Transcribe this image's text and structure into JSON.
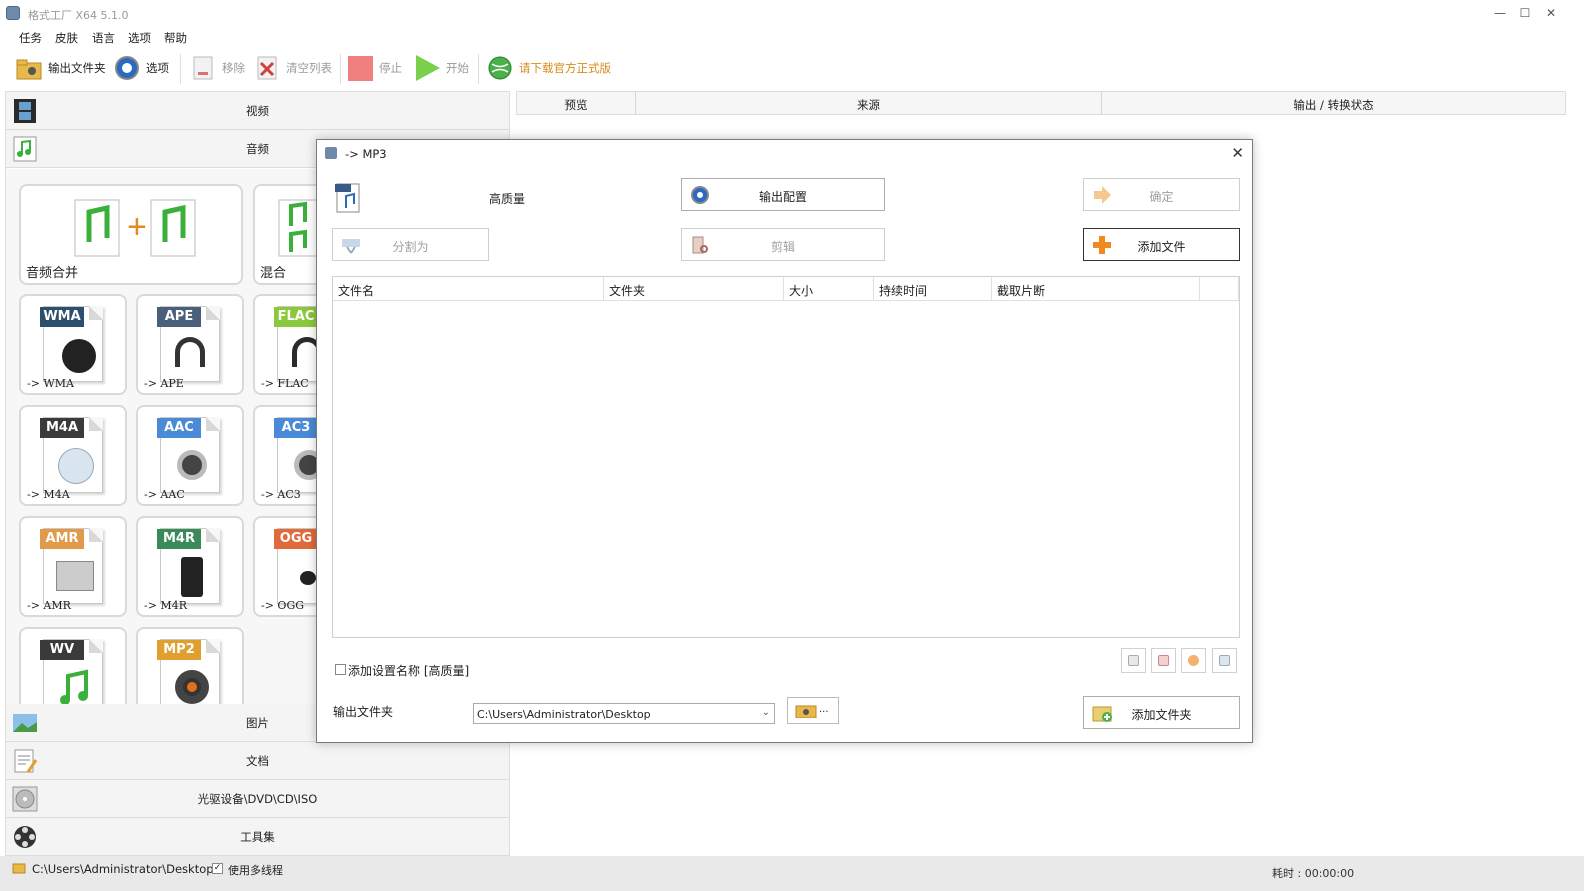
{
  "window": {
    "title": "格式工厂 X64 5.1.0",
    "min": "—",
    "max": "☐",
    "close": "✕"
  },
  "menu": [
    "任务",
    "皮肤",
    "语言",
    "选项",
    "帮助"
  ],
  "toolbar": {
    "output_folder": "输出文件夹",
    "options": "选项",
    "remove": "移除",
    "clear": "清空列表",
    "stop": "停止",
    "start": "开始",
    "download": "请下载官方正式版"
  },
  "categories": {
    "video": "视频",
    "audio": "音频",
    "image": "图片",
    "document": "文档",
    "rom": "光驱设备\\DVD\\CD\\ISO",
    "tools": "工具集"
  },
  "tiles": {
    "merge": "音频合并",
    "mix": "混合",
    "formats": [
      {
        "badge": "WMA",
        "label": "-> WMA",
        "color": "#2d4f6d"
      },
      {
        "badge": "APE",
        "label": "-> APE",
        "color": "#4a5f7a"
      },
      {
        "badge": "FLAC",
        "label": "-> FLAC",
        "color": "#8cc83c"
      },
      {
        "badge": "M4A",
        "label": "-> M4A",
        "color": "#3a3a3a"
      },
      {
        "badge": "AAC",
        "label": "-> AAC",
        "color": "#4a8ad6"
      },
      {
        "badge": "AC3",
        "label": "-> AC3",
        "color": "#4a8ad6"
      },
      {
        "badge": "AMR",
        "label": "-> AMR",
        "color": "#e09a4a"
      },
      {
        "badge": "M4R",
        "label": "-> M4R",
        "color": "#3a8a5a"
      },
      {
        "badge": "OGG",
        "label": "-> OGG",
        "color": "#e06a3a"
      },
      {
        "badge": "WV",
        "label": "",
        "color": "#3a3a3a"
      },
      {
        "badge": "MP2",
        "label": "",
        "color": "#e0a030"
      }
    ]
  },
  "list_header": {
    "preview": "预览",
    "source": "来源",
    "output": "输出 / 转换状态"
  },
  "dialog": {
    "title": "-> MP3",
    "close": "✕",
    "quality": "高质量",
    "output_config": "输出配置",
    "ok": "确定",
    "split": "分割为",
    "cut": "剪辑",
    "add_file": "添加文件",
    "columns": [
      "文件名",
      "文件夹",
      "大小",
      "持续时间",
      "截取片断"
    ],
    "add_name_checkbox": "添加设置名称 [高质量]",
    "output_folder_label": "输出文件夹",
    "output_path": "C:\\Users\\Administrator\\Desktop",
    "browse": "...",
    "add_folder": "添加文件夹"
  },
  "status": {
    "path": "C:\\Users\\Administrator\\Desktop",
    "multithread": "使用多线程",
    "elapsed": "耗时 : 00:00:00"
  }
}
